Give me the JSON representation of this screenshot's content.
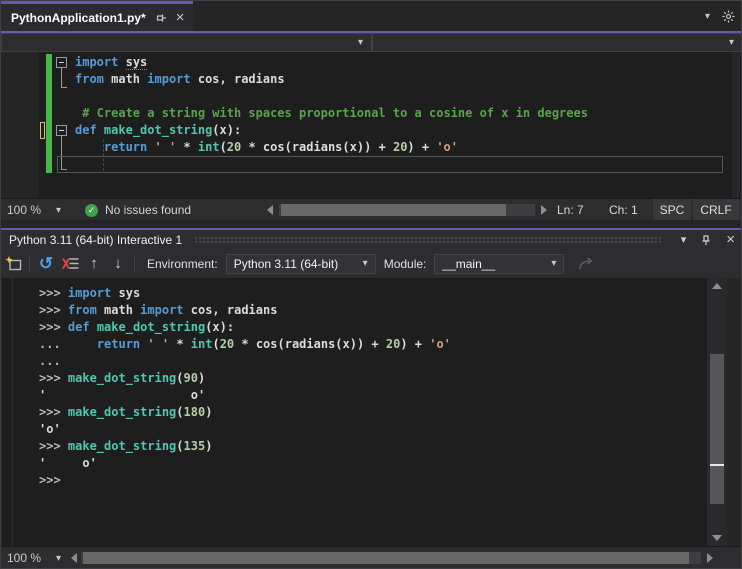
{
  "colors": {
    "accent": "#635BB1",
    "keyword": "#569CD6",
    "function": "#4EC9B0",
    "string": "#D69D85",
    "number": "#B5CEA8",
    "comment": "#57A64A",
    "text": "#DCDCDC",
    "prompt": "#BBBBBB",
    "change_bar_saved": "#4CB648",
    "change_bar_unsaved": "#D7BA7D",
    "issues_check": "#3FA34D",
    "reset_icon_blue": "#4DA0E0",
    "clear_icon_red": "#D64A4A"
  },
  "icons": {
    "chevron_down": "▾",
    "close": "×",
    "check": "✓",
    "reset": "↺",
    "arrow_up": "↑",
    "arrow_down": "↓"
  },
  "tab_bar": {
    "tab_title": "PythonApplication1.py*"
  },
  "nav_bar": {
    "left_value": "",
    "right_value": ""
  },
  "editor": {
    "lines": [
      [
        [
          "kw",
          "import"
        ],
        [
          "pl",
          " "
        ],
        [
          "und",
          "sys"
        ]
      ],
      [
        [
          "kw",
          "from"
        ],
        [
          "pl",
          " math "
        ],
        [
          "kw",
          "import"
        ],
        [
          "pl",
          " cos, radians"
        ]
      ],
      [],
      [
        [
          "com",
          " # Create a string with spaces proportional to a cosine of x in degrees"
        ]
      ],
      [
        [
          "kw",
          "def"
        ],
        [
          "pl",
          " "
        ],
        [
          "fn",
          "make_dot_string"
        ],
        [
          "pl",
          "(x):"
        ]
      ],
      [
        [
          "pl",
          "    "
        ],
        [
          "kw",
          "return"
        ],
        [
          "pl",
          " "
        ],
        [
          "str",
          "' '"
        ],
        [
          "pl",
          " * "
        ],
        [
          "fn",
          "int"
        ],
        [
          "pl",
          "("
        ],
        [
          "num",
          "20"
        ],
        [
          "pl",
          " * cos(radians(x)) + "
        ],
        [
          "num",
          "20"
        ],
        [
          "pl",
          ") + "
        ],
        [
          "str",
          "'o'"
        ]
      ],
      []
    ],
    "status": {
      "zoom": "100 %",
      "issues": "No issues found",
      "line": "Ln: 7",
      "column": "Ch: 1",
      "spaces": "SPC",
      "line_ending": "CRLF"
    }
  },
  "interactive": {
    "title": "Python 3.11 (64-bit) Interactive 1",
    "toolbar": {
      "environment_label": "Environment:",
      "environment_value": "Python 3.11 (64-bit)",
      "module_label": "Module:",
      "module_value": "__main__"
    },
    "lines": [
      [
        [
          "prompt",
          ">>> "
        ],
        [
          "kw",
          "import"
        ],
        [
          "pl",
          " sys"
        ]
      ],
      [
        [
          "prompt",
          ">>> "
        ],
        [
          "kw",
          "from"
        ],
        [
          "pl",
          " math "
        ],
        [
          "kw",
          "import"
        ],
        [
          "pl",
          " cos, radians"
        ]
      ],
      [
        [
          "prompt",
          ">>> "
        ],
        [
          "kw",
          "def"
        ],
        [
          "pl",
          " "
        ],
        [
          "fn",
          "make_dot_string"
        ],
        [
          "pl",
          "(x):"
        ]
      ],
      [
        [
          "prompt",
          "... "
        ],
        [
          "pl",
          "    "
        ],
        [
          "kw",
          "return"
        ],
        [
          "pl",
          " "
        ],
        [
          "str",
          "' '"
        ],
        [
          "pl",
          " * "
        ],
        [
          "fn",
          "int"
        ],
        [
          "pl",
          "("
        ],
        [
          "num",
          "20"
        ],
        [
          "pl",
          " * cos(radians(x)) + "
        ],
        [
          "num",
          "20"
        ],
        [
          "pl",
          ") + "
        ],
        [
          "str",
          "'o'"
        ]
      ],
      [
        [
          "prompt",
          "..."
        ]
      ],
      [
        [
          "prompt",
          ">>> "
        ],
        [
          "fn",
          "make_dot_string"
        ],
        [
          "pl",
          "("
        ],
        [
          "num",
          "90"
        ],
        [
          "pl",
          ")"
        ]
      ],
      [
        [
          "out",
          "'                    o'"
        ]
      ],
      [
        [
          "prompt",
          ">>> "
        ],
        [
          "fn",
          "make_dot_string"
        ],
        [
          "pl",
          "("
        ],
        [
          "num",
          "180"
        ],
        [
          "pl",
          ")"
        ]
      ],
      [
        [
          "out",
          "'o'"
        ]
      ],
      [
        [
          "prompt",
          ">>> "
        ],
        [
          "fn",
          "make_dot_string"
        ],
        [
          "pl",
          "("
        ],
        [
          "num",
          "135"
        ],
        [
          "pl",
          ")"
        ]
      ],
      [
        [
          "out",
          "'     o'"
        ]
      ],
      [
        [
          "prompt",
          ">>>"
        ]
      ]
    ],
    "status": {
      "zoom": "100 %"
    }
  }
}
